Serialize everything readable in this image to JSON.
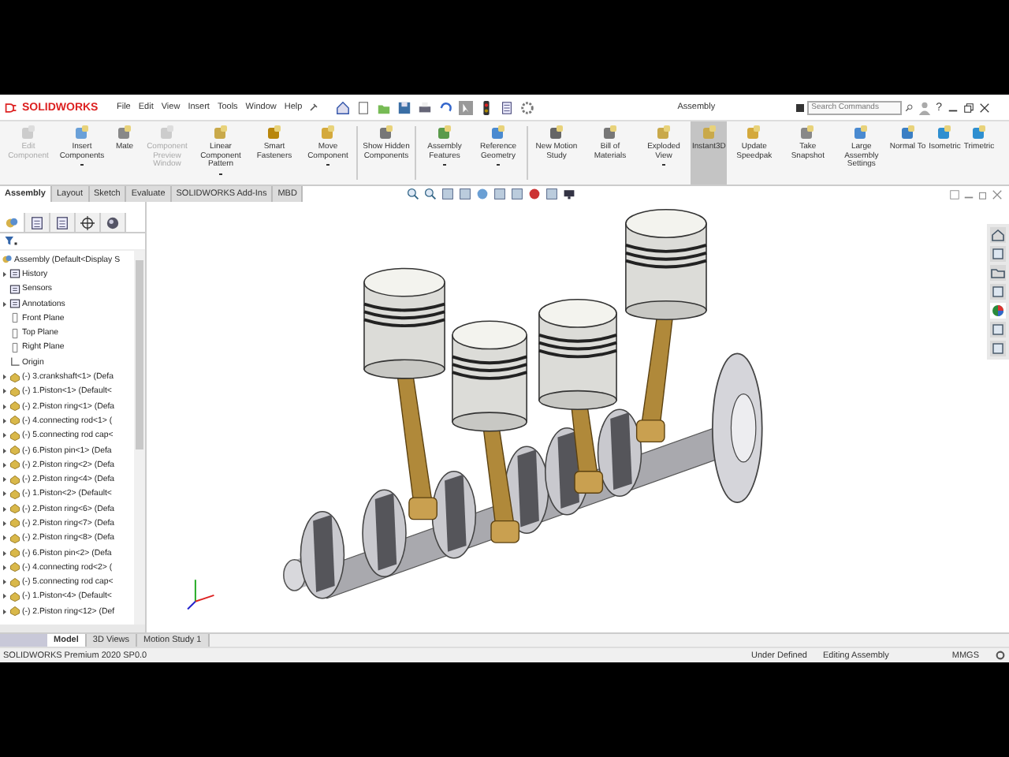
{
  "title_bar": {
    "logo": "SOLIDWORKS",
    "menus": [
      "File",
      "Edit",
      "View",
      "Insert",
      "Tools",
      "Window",
      "Help"
    ],
    "title": "Assembly",
    "search": {
      "placeholder": "Search Commands"
    },
    "help": "?"
  },
  "command_groups": [
    [
      {
        "label": "Edit Component",
        "disabled": true,
        "dropdown": false,
        "on": false
      },
      {
        "label": "Insert Components",
        "disabled": false,
        "dropdown": true,
        "on": false
      },
      {
        "label": "Mate",
        "disabled": false,
        "dropdown": false,
        "on": false
      },
      {
        "label": "Component Preview Window",
        "disabled": true,
        "dropdown": false,
        "on": false
      },
      {
        "label": "Linear Component Pattern",
        "disabled": false,
        "dropdown": true,
        "on": false
      },
      {
        "label": "Smart Fasteners",
        "disabled": false,
        "dropdown": false,
        "on": false
      },
      {
        "label": "Move Component",
        "disabled": false,
        "dropdown": true,
        "on": false
      }
    ],
    [
      {
        "label": "Show Hidden Components",
        "disabled": false,
        "dropdown": false,
        "on": false
      }
    ],
    [
      {
        "label": "Assembly Features",
        "disabled": false,
        "dropdown": true,
        "on": false
      },
      {
        "label": "Reference Geometry",
        "disabled": false,
        "dropdown": true,
        "on": false
      }
    ],
    [
      {
        "label": "New Motion Study",
        "disabled": false,
        "dropdown": false,
        "on": false
      },
      {
        "label": "Bill of Materials",
        "disabled": false,
        "dropdown": false,
        "on": false
      },
      {
        "label": "Exploded View",
        "disabled": false,
        "dropdown": true,
        "on": false
      },
      {
        "label": "Instant3D",
        "disabled": false,
        "dropdown": false,
        "on": true
      },
      {
        "label": "Update Speedpak",
        "disabled": false,
        "dropdown": false,
        "on": false
      },
      {
        "label": "Take Snapshot",
        "disabled": false,
        "dropdown": false,
        "on": false
      },
      {
        "label": "Large Assembly Settings",
        "disabled": false,
        "dropdown": false,
        "on": false
      },
      {
        "label": "Normal To",
        "disabled": false,
        "dropdown": false,
        "on": false
      },
      {
        "label": "Isometric",
        "disabled": false,
        "dropdown": false,
        "on": false
      },
      {
        "label": "Trimetric",
        "disabled": false,
        "dropdown": false,
        "on": false
      }
    ]
  ],
  "tabs": [
    {
      "label": "Assembly",
      "selected": true
    },
    {
      "label": "Layout",
      "selected": false
    },
    {
      "label": "Sketch",
      "selected": false
    },
    {
      "label": "Evaluate",
      "selected": false
    },
    {
      "label": "SOLIDWORKS Add-Ins",
      "selected": false
    },
    {
      "label": "MBD",
      "selected": false
    }
  ],
  "feature_tree": {
    "panel_tabs": [
      {
        "selected": true
      },
      {
        "selected": false
      },
      {
        "selected": false
      },
      {
        "selected": false
      },
      {
        "selected": false
      }
    ],
    "root": "Assembly  (Default<Display S",
    "items": [
      {
        "label": "History",
        "kind": "folder",
        "expanded": false
      },
      {
        "label": "Sensors",
        "kind": "folder"
      },
      {
        "label": "Annotations",
        "kind": "folder",
        "expanded": false
      },
      {
        "label": "Front Plane",
        "kind": "plane"
      },
      {
        "label": "Top Plane",
        "kind": "plane"
      },
      {
        "label": "Right Plane",
        "kind": "plane"
      },
      {
        "label": "Origin",
        "kind": "origin"
      },
      {
        "label": "(-) 3.crankshaft<1> (Defa",
        "kind": "component",
        "expanded": false
      },
      {
        "label": "(-) 1.Piston<1> (Default<",
        "kind": "component",
        "expanded": false
      },
      {
        "label": "(-) 2.Piston ring<1> (Defa",
        "kind": "component",
        "expanded": false
      },
      {
        "label": "(-) 4.connecting rod<1> (",
        "kind": "component",
        "expanded": false
      },
      {
        "label": "(-) 5.connecting rod cap<",
        "kind": "component",
        "expanded": false
      },
      {
        "label": "(-) 6.Piston pin<1> (Defa",
        "kind": "component",
        "expanded": false
      },
      {
        "label": "(-) 2.Piston ring<2> (Defa",
        "kind": "component",
        "expanded": false
      },
      {
        "label": "(-) 2.Piston ring<4> (Defa",
        "kind": "component",
        "expanded": false
      },
      {
        "label": "(-) 1.Piston<2> (Default<",
        "kind": "component",
        "expanded": false
      },
      {
        "label": "(-) 2.Piston ring<6> (Defa",
        "kind": "component",
        "expanded": false
      },
      {
        "label": "(-) 2.Piston ring<7> (Defa",
        "kind": "component",
        "expanded": false
      },
      {
        "label": "(-) 2.Piston ring<8> (Defa",
        "kind": "component",
        "expanded": false
      },
      {
        "label": "(-) 6.Piston pin<2> (Defa",
        "kind": "component",
        "expanded": false
      },
      {
        "label": "(-) 4.connecting rod<2> (",
        "kind": "component",
        "expanded": false
      },
      {
        "label": "(-) 5.connecting rod cap<",
        "kind": "component",
        "expanded": false
      },
      {
        "label": "(-) 1.Piston<4> (Default<",
        "kind": "component",
        "expanded": false
      },
      {
        "label": "(-) 2.Piston ring<12> (Def",
        "kind": "component",
        "expanded": false
      }
    ]
  },
  "bottom_tabs": [
    {
      "label": "Model",
      "selected": true
    },
    {
      "label": "3D Views",
      "selected": false
    },
    {
      "label": "Motion Study 1",
      "selected": false
    }
  ],
  "status_bar": {
    "product": "SOLIDWORKS Premium 2020 SP0.0",
    "state": "Under Defined",
    "mode": "Editing Assembly",
    "units": "MMGS"
  }
}
